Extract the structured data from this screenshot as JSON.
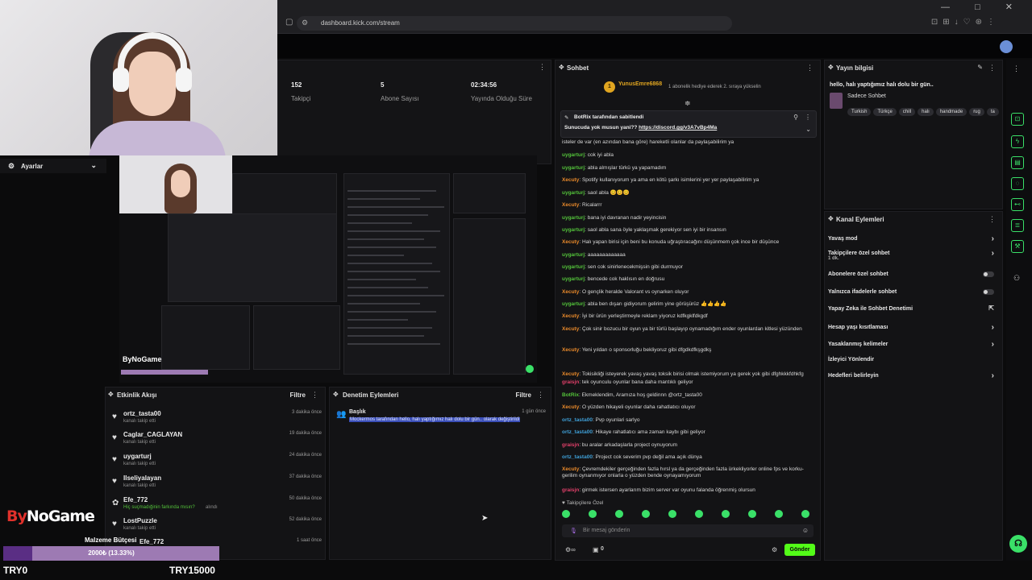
{
  "browser": {
    "url": "dashboard.kick.com/stream",
    "window_controls": "— □ ✕"
  },
  "stats": [
    {
      "value": "152",
      "label": "Takipçi"
    },
    {
      "value": "5",
      "label": "Abone Sayısı"
    },
    {
      "value": "02:34:56",
      "label": "Yayında Olduğu Süre"
    }
  ],
  "settings": {
    "label": "Ayarlar"
  },
  "activity": {
    "title": "Etkinlik Akışı",
    "filter": "Filtre",
    "items": [
      {
        "user": "ortz_tasta00",
        "sub": "kanalı takip etti",
        "time": "3 dakika önce"
      },
      {
        "user": "Caglar_CAGLAYAN",
        "sub": "kanalı takip etti",
        "time": "19 dakika önce"
      },
      {
        "user": "uygarturj",
        "sub": "kanalı takip etti",
        "time": "24 dakika önce"
      },
      {
        "user": "Ilseliyalayan",
        "sub": "kanalı takip etti",
        "time": "37 dakika önce"
      },
      {
        "user": "Efe_772",
        "sub": "Hiç suçmadığinin farkında mısın?",
        "sub2": "alındı",
        "time": "50 dakika önce"
      },
      {
        "user": "LostPuzzle",
        "sub": "kanalı takip etti",
        "time": "52 dakika önce"
      },
      {
        "user": "Efe_772",
        "sub": "",
        "time": "1 saat önce"
      }
    ]
  },
  "moderation": {
    "title": "Denetim Eylemleri",
    "filter": "Filtre",
    "item_title": "Başlık",
    "item_time": "1 gün önce",
    "item_text": "Mockermos tarafından hello, halı yaptığımız halı dolu bir gün.. olarak değiştirildi"
  },
  "chat": {
    "title": "Sohbet",
    "top_user": "YunusEmre6868",
    "top_user_badge": "1",
    "top_note": "1 abonelik hediye ederek 2. sıraya yükselin",
    "pinned_by": "BotRix tarafından sabitlendi",
    "pinned_text": "Sunucuda yok musun yani?? ",
    "pinned_link": "https://discord.gg/v3A7vBp4Ma",
    "followers_only": "Takipçilere Özel",
    "input_placeholder": "Bir mesaj gönderin",
    "send": "Gönder",
    "count": "0",
    "messages": [
      {
        "u": "",
        "t": "isteler de var (en azından bana göre) hareketli olanlar da paylaşabilirim ya",
        "c": "#d9d9d9"
      },
      {
        "u": "uygarturj",
        "t": ": cok iyi abla",
        "c": "#53c23a"
      },
      {
        "u": "uygarturj",
        "t": ": abla almışlar türkü ya yapamadım",
        "c": "#53c23a"
      },
      {
        "u": "Xecuty",
        "t": ": Spotify kullanıyorum ya ama en kötü şarkı isimlerini yer yer paylaşabilirim ya",
        "c": "#e98a2b"
      },
      {
        "u": "uygarturj",
        "t": ": saol abla 😊😊😊",
        "c": "#53c23a"
      },
      {
        "u": "Xecuty",
        "t": ": Ricalarrr",
        "c": "#e98a2b"
      },
      {
        "u": "uygarturj",
        "t": ": bana iyi davranan nadir yeyincisin",
        "c": "#53c23a"
      },
      {
        "u": "uygarturj",
        "t": ": saol abla sana öyle yaklaşmak gerekiyor sen iyi bir insansın",
        "c": "#53c23a"
      },
      {
        "u": "Xecuty",
        "t": ": Halı yapan birisi için beni bu konuda uğraştıracağını düşünmem çok ince bir düşünce",
        "c": "#e98a2b"
      },
      {
        "u": "uygarturj",
        "t": ": aaaaaaaaaaaaa",
        "c": "#53c23a"
      },
      {
        "u": "uygarturj",
        "t": ": sen cok sinirlenecekmişsin gibi durmuyor",
        "c": "#53c23a"
      },
      {
        "u": "uygarturj",
        "t": ": bencede cok haklısın en doğrusu",
        "c": "#53c23a"
      },
      {
        "u": "Xecuty",
        "t": ": O gençlik heralde Valorant vs oynarken oluyor",
        "c": "#e98a2b"
      },
      {
        "u": "uygarturj",
        "t": ": abla ben dışarı gidiyorum gelirim yine görüşürüz 👍👍👍👍",
        "c": "#53c23a"
      },
      {
        "u": "Xecuty",
        "t": ": İyi bir ürün yerleştirmeyle reklam yiyoruz kdfkgklfdkgdf",
        "c": "#e98a2b"
      },
      {
        "u": "Xecuty",
        "t": ": Çok sinir bozucu bir oyun ya bir türlü başlayıp oynamadığım ender oyunlardan kitlesi yüzünden",
        "c": "#e98a2b"
      },
      {
        "u": "Xecuty",
        "t": ": Yeni yıldan o sponsorluğu bekliyoruz gibi dfgdkdfkşgdkş",
        "c": "#e98a2b"
      },
      {
        "u": "Xecuty",
        "t": ": Tokisikliği isteyerek yavaş yavaş toksik birisi olmak istemiyorum ya gerek yok gibi dfghkkkfdhkfg",
        "c": "#e98a2b"
      },
      {
        "u": "graisjn",
        "t": ": tek oyunculu oyunlar bana daha mantıklı geliyor",
        "c": "#e2406a"
      },
      {
        "u": "BotRix",
        "t": ": Ekmeklendim, Aramıza hoş geldinnn @ortz_tasta00",
        "c": "#53c23a"
      },
      {
        "u": "Xecuty",
        "t": ": O yüzden hikayeli oyunlar daha rahatlatıcı oluyor",
        "c": "#e98a2b"
      },
      {
        "u": "ortz_tasta00",
        "t": ": Pvp oyunlari sarlyo",
        "c": "#3fa0d8"
      },
      {
        "u": "ortz_tasta00",
        "t": ": Hikaye rahatlatıcı ama zaman kaybı gibi geliyor",
        "c": "#3fa0d8"
      },
      {
        "u": "graisjn",
        "t": ": bu aralar arkadaşlarla project oynuyorum",
        "c": "#e2406a"
      },
      {
        "u": "ortz_tasta00",
        "t": ": Project cok severim pvp değil ama açık dünya",
        "c": "#3fa0d8"
      },
      {
        "u": "Xecuty",
        "t": ": Çevremdekiler gerçeğinden fazla hırsl ya da gerçeğinden fazla ürkekliyorler online fps ve korku-gerilim oynanmıyor onlarla o yüzden bende oynayamıyorum",
        "c": "#e98a2b"
      },
      {
        "u": "graisjn",
        "t": ": girmek istersen ayarlarım bizim server var oyunu falanda öğrenmiş olursun",
        "c": "#e2406a"
      }
    ]
  },
  "streaminfo": {
    "title": "Yayın bilgisi",
    "stream_title": "hello, halı yaptığımız halı dolu bir gün..",
    "category": "Sadece Sohbet",
    "tags": [
      "Turkish",
      "Türkçe",
      "chill",
      "halı",
      "handmade",
      "rug",
      "ta"
    ]
  },
  "channelactions": {
    "title": "Kanal Eylemleri",
    "items": [
      {
        "label": "Yavaş mod",
        "kind": "chevron"
      },
      {
        "label": "Takipçilere özel sohbet",
        "sub": "1 dk.",
        "kind": "chevron"
      },
      {
        "label": "Abonelere özel sohbet",
        "kind": "toggle"
      },
      {
        "label": "Yalnızca ifadelerle sohbet",
        "kind": "toggle"
      },
      {
        "label": "Yapay Zeka ile Sohbet Denetimi",
        "kind": "link"
      },
      {
        "label": "Hesap yaşı kısıtlaması",
        "kind": "chevron"
      },
      {
        "label": "Yasaklanmış kelimeler",
        "kind": "chevron"
      },
      {
        "label": "İzleyici Yönlendir",
        "kind": "none"
      },
      {
        "label": "Hedefleri belirleyin",
        "kind": "chevron"
      }
    ]
  },
  "overlay": {
    "logo_a": "By",
    "logo_b": "NoGame",
    "progress_label": "Malzeme Bütçesi",
    "progress_text": "2000₺ (13.33%)",
    "progress_fraction": 0.1333,
    "min": "TRY0",
    "max": "TRY15000"
  }
}
